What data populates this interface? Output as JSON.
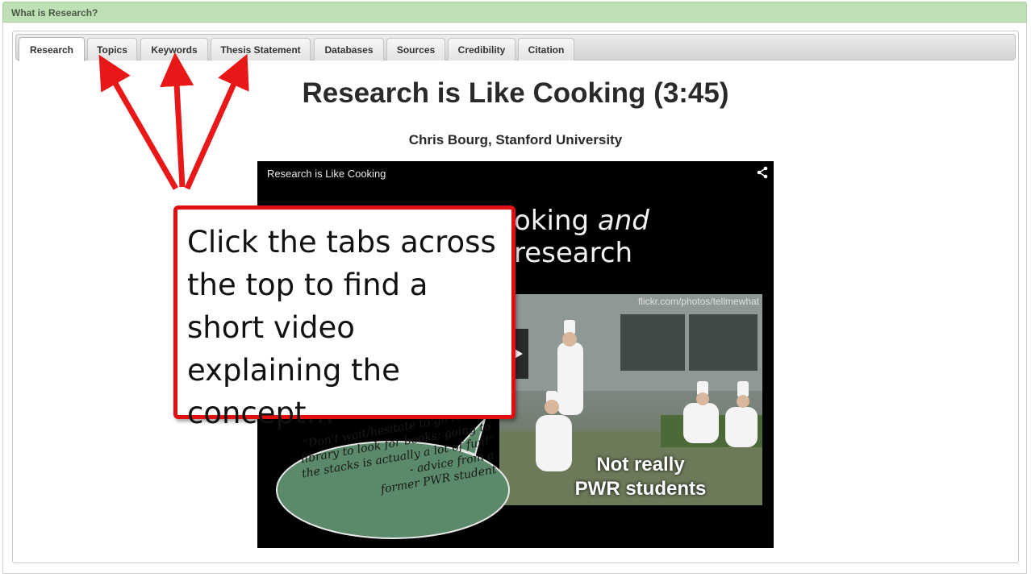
{
  "panel": {
    "title": "What is Research?"
  },
  "tabs": [
    {
      "label": "Research",
      "active": true
    },
    {
      "label": "Topics"
    },
    {
      "label": "Keywords"
    },
    {
      "label": "Thesis Statement"
    },
    {
      "label": "Databases"
    },
    {
      "label": "Sources"
    },
    {
      "label": "Credibility"
    },
    {
      "label": "Citation"
    }
  ],
  "content": {
    "title": "Research is Like Cooking (3:45)",
    "author": "Chris Bourg, Stanford University"
  },
  "video": {
    "title": "Research is Like Cooking",
    "slide_heading_plain1": "oking ",
    "slide_heading_italic": "and",
    "slide_heading_plain2": " research",
    "photo_credit": "flickr.com/photos/tellmewhat",
    "photo_caption_line1": "Not really",
    "photo_caption_line2": "PWR students",
    "bubble_quote": "“Don't wait/hesitate to go to the library to look for books; going to the stacks is actually a lot of fun!”",
    "bubble_attribution_line1": "- advice from a",
    "bubble_attribution_line2": "former PWR student"
  },
  "callout": {
    "text": "Click the tabs across the top to find a short video explaining the concept..."
  },
  "colors": {
    "header_bg": "#bfe0b6",
    "callout_border": "#e01010",
    "arrow": "#e81818",
    "bubble_fill": "#5a8a6a"
  }
}
